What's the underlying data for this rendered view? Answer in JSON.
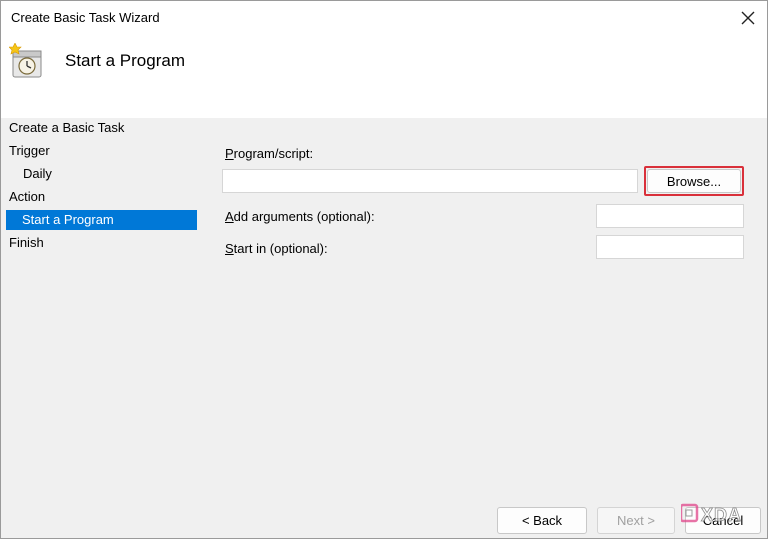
{
  "window": {
    "title": "Create Basic Task Wizard"
  },
  "header": {
    "title": "Start a Program",
    "icon": "task-clock-icon"
  },
  "sidebar": {
    "items": [
      {
        "label": "Create a Basic Task",
        "selected": false
      },
      {
        "label": "Trigger",
        "selected": false
      },
      {
        "label": "Daily",
        "selected": false
      },
      {
        "label": "Action",
        "selected": false
      },
      {
        "label": "Start a Program",
        "selected": true
      },
      {
        "label": "Finish",
        "selected": false
      }
    ]
  },
  "form": {
    "program": {
      "mnemonic": "P",
      "rest": "rogram/script:",
      "value": ""
    },
    "browse": {
      "mnemonic": "B",
      "rest": "rowse..."
    },
    "arguments": {
      "mnemonic": "A",
      "rest": "dd arguments (optional):",
      "value": ""
    },
    "start_in": {
      "mnemonic": "S",
      "rest": "tart in (optional):",
      "value": ""
    }
  },
  "footer": {
    "back": {
      "prefix": "< ",
      "mnemonic": "B",
      "rest": "ack"
    },
    "next": {
      "mnemonic": "N",
      "rest": "ext >",
      "disabled": true
    },
    "cancel": "Cancel"
  },
  "watermark": "XDA",
  "colors": {
    "selection": "#0078d7",
    "highlight": "#d9303a"
  }
}
